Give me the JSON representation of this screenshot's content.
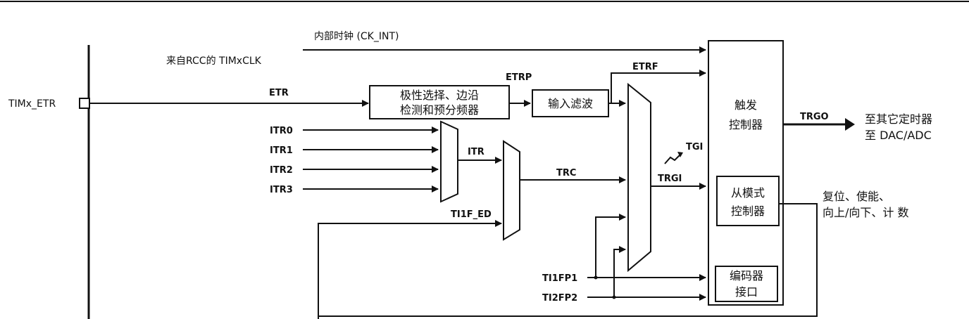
{
  "labels": {
    "ck_int": "内部时钟 (CK_INT)",
    "timxclk": "来自RCC的 TIMxCLK",
    "timx_etr": "TIMx_ETR",
    "etr": "ETR",
    "etrp": "ETRP",
    "etrf": "ETRF",
    "itr0": "ITR0",
    "itr1": "ITR1",
    "itr2": "ITR2",
    "itr3": "ITR3",
    "itr": "ITR",
    "trc": "TRC",
    "ti1f_ed": "TI1F_ED",
    "tgi": "TGI",
    "trgi": "TRGI",
    "trgo": "TRGO",
    "ti1fp1": "TI1FP1",
    "ti2fp2": "TI2FP2"
  },
  "boxes": {
    "polarity_line1": "极性选择、边沿",
    "polarity_line2": "检测和预分频器",
    "input_filter": "输入滤波",
    "trigger_line1": "触发",
    "trigger_line2": "控制器",
    "slave_line1": "从模式",
    "slave_line2": "控制器",
    "encoder_line1": "编码器",
    "encoder_line2": "接口"
  },
  "outputs": {
    "trgo_line1": "至其它定时器",
    "trgo_line2": "至 DAC/ADC",
    "slave_line1": "复位、使能、",
    "slave_line2": "向上/向下、计 数"
  }
}
